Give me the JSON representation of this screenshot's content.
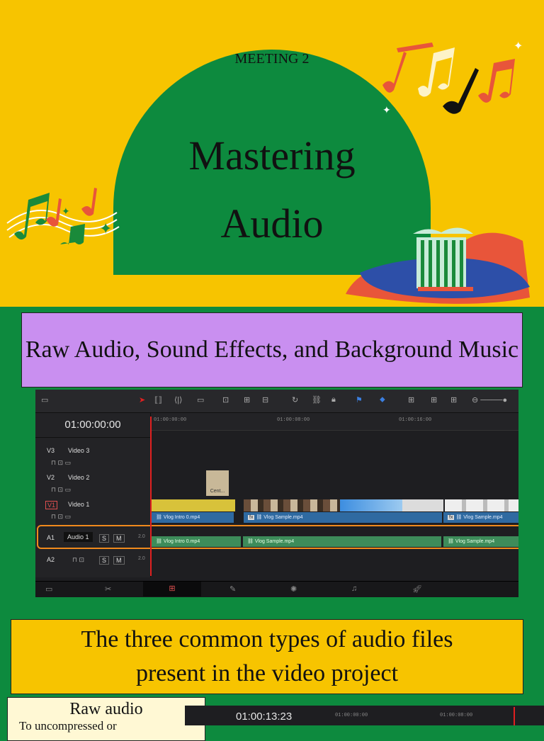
{
  "header": {
    "meeting": "MEETING 2",
    "title_line1": "Mastering",
    "title_line2": "Audio"
  },
  "section1": {
    "heading": "Raw Audio, Sound Effects, and Background Music"
  },
  "editor": {
    "timecode": "01:00:00:00",
    "ruler_labels": [
      "01:00:00:00",
      "01:00:08:00",
      "01:00:16:00"
    ],
    "tracks": {
      "v3": {
        "id": "V3",
        "name": "Video 3"
      },
      "v2": {
        "id": "V2",
        "name": "Video 2"
      },
      "v1": {
        "id": "V1",
        "name": "Video 1"
      },
      "a1": {
        "id": "A1",
        "name": "Audio 1",
        "level": "2.0",
        "solo": "S",
        "mute": "M"
      },
      "a2": {
        "id": "A2",
        "level": "2.0",
        "solo": "S",
        "mute": "M"
      }
    },
    "v2_clip_label": "Cent...",
    "video_clips": [
      "Vlog Intro 0.mp4",
      "Vlog Sample.mp4",
      "Vlog Sample.mp4"
    ],
    "audio_clips": [
      "Vlog Intro 0.mp4",
      "Vlog Sample.mp4",
      "Vlog Sample.mp4"
    ],
    "fx_badge": "fx"
  },
  "section2": {
    "heading": "The three common types of audio files present in the video project"
  },
  "card": {
    "title": "Raw audio",
    "text": "To uncompressed or"
  },
  "editor2": {
    "timecode": "01:00:13:23",
    "ruler_labels": [
      "01:00:00:00",
      "01:00:08:00"
    ]
  },
  "colors": {
    "yellow": "#f7c400",
    "green": "#0d8a3e",
    "purple": "#c98ff0",
    "orange_highlight": "#f08a1c",
    "playhead": "#e02020"
  },
  "icons": [
    "music-note-icon",
    "sparkle-icon",
    "pillar-icon",
    "arrow-select-icon",
    "link-icon",
    "lock-icon",
    "flag-icon",
    "zoom-icon"
  ]
}
